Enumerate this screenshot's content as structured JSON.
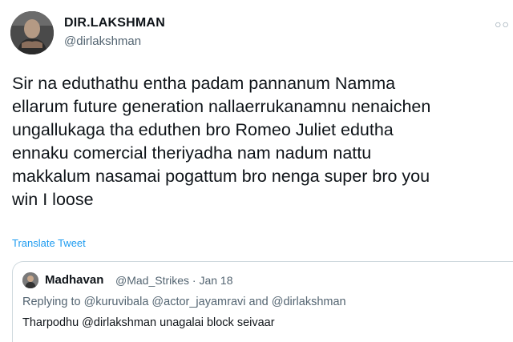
{
  "author": {
    "name": "DIR.LAKSHMAN",
    "handle": "@dirlakshman"
  },
  "more_icon": "more-options-icon",
  "tweet": {
    "lines": [
      "Sir na eduthathu entha padam pannanum Namma",
      "ellarum future generation nallaerrukanamnu nenaichen",
      "ungallukaga tha eduthen bro Romeo Juliet edutha",
      "ennaku comercial theriyadha nam nadum nattu",
      "makkalum nasamai pogattum bro nenga super bro you",
      "win I loose"
    ],
    "translate_label": "Translate Tweet"
  },
  "quoted_tweet": {
    "name": "Madhavan",
    "handle_date": "@Mad_Strikes · Jan 18",
    "replying_to": "Replying to @kuruvibala @actor_jayamravi and @dirlakshman",
    "text": "Tharpodhu @dirlakshman unagalai block seivaar"
  },
  "colors": {
    "link": "#1d9bf0",
    "secondary_text": "#536471",
    "border": "#cfd9de"
  }
}
